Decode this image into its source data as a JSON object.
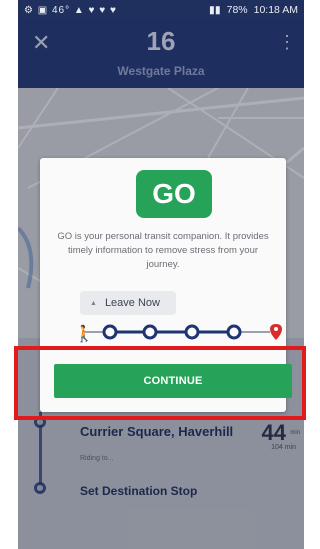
{
  "status_bar": {
    "left_icons": [
      "⚙",
      "▣",
      "46°",
      "▲",
      "♥",
      "♥",
      "♥"
    ],
    "battery": "78%",
    "time": "10:18 AM"
  },
  "header": {
    "route_number": "16",
    "route_name": "Westgate Plaza"
  },
  "dialog": {
    "badge": "GO",
    "description": "GO is your personal transit companion. It provides timely information to remove stress from your journey.",
    "leave_now": "Leave Now",
    "continue_label": "CONTINUE"
  },
  "trip": {
    "stop_name": "Currier Square, Haverhill",
    "status": "Riding to...",
    "eta": "44",
    "eta_unit": "min",
    "eta_alt": "104 min",
    "set_destination": "Set Destination Stop"
  },
  "colors": {
    "header_bg": "#1f3472",
    "go_green": "#27a359",
    "highlight_red": "#e01b1b",
    "track_blue": "#1f3472",
    "destination_red": "#d92b2b"
  }
}
